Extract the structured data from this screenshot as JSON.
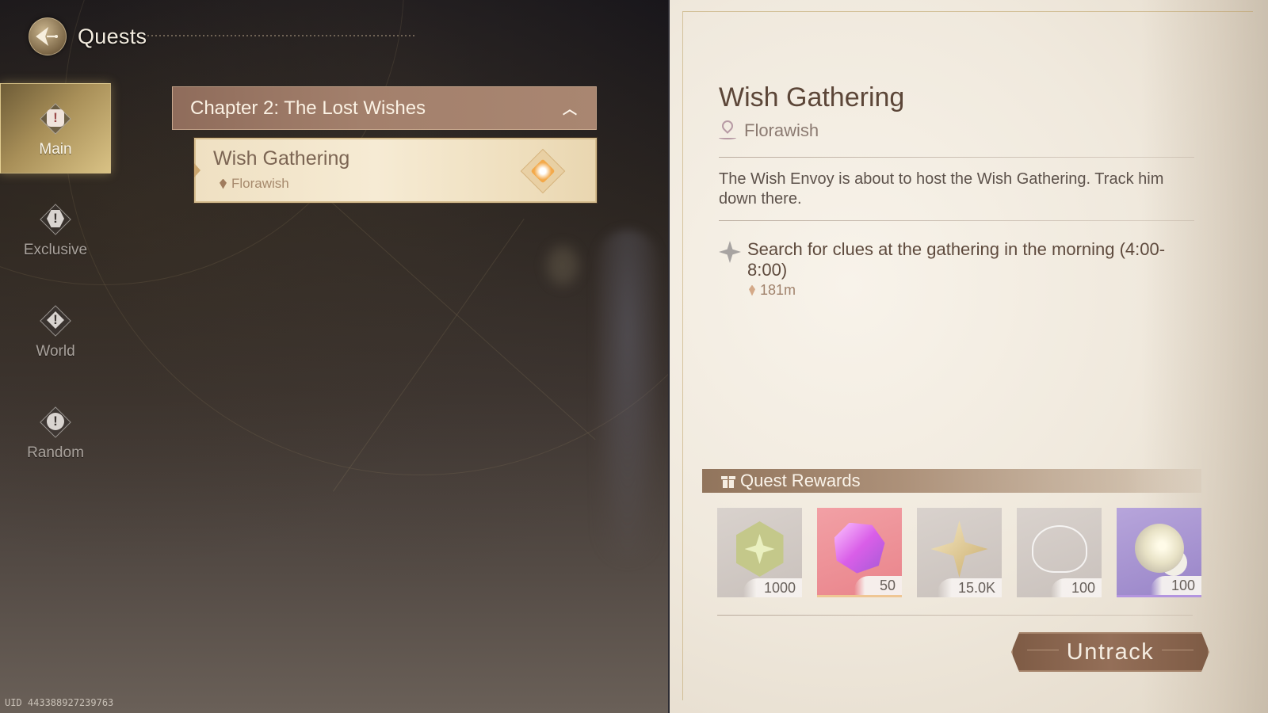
{
  "header": {
    "title": "Quests",
    "icon": "quests-emblem-icon"
  },
  "sidebar": {
    "items": [
      {
        "label": "Main",
        "icon": "main-quest-icon",
        "active": true
      },
      {
        "label": "Exclusive",
        "icon": "exclusive-quest-icon",
        "active": false
      },
      {
        "label": "World",
        "icon": "world-quest-icon",
        "active": false
      },
      {
        "label": "Random",
        "icon": "random-quest-icon",
        "active": false
      }
    ]
  },
  "quest_list": {
    "chapter": {
      "title": "Chapter 2: The Lost Wishes",
      "toggle_icon": "chevron-up-icon",
      "expanded": true
    },
    "quests": [
      {
        "title": "Wish Gathering",
        "location": "Florawish",
        "tracked": true
      }
    ]
  },
  "detail": {
    "title": "Wish Gathering",
    "location": "Florawish",
    "description": "The Wish Envoy is about to host the Wish Gathering. Track him down there.",
    "objective": {
      "text": "Search for clues at the gathering in the morning (4:00-8:00)",
      "distance": "181m"
    },
    "rewards_title": "Quest Rewards",
    "rewards": [
      {
        "name": "badge-item",
        "quantity": "1000",
        "rarity": "common"
      },
      {
        "name": "pink-crystal",
        "quantity": "50",
        "rarity": "rare"
      },
      {
        "name": "gold-flower",
        "quantity": "15.0K",
        "rarity": "common"
      },
      {
        "name": "silver-bow-thread",
        "quantity": "100",
        "rarity": "common"
      },
      {
        "name": "pearl-orb",
        "quantity": "100",
        "rarity": "epic"
      }
    ],
    "action_button": "Untrack"
  },
  "footer": {
    "uid": "UID 443388927239763"
  }
}
